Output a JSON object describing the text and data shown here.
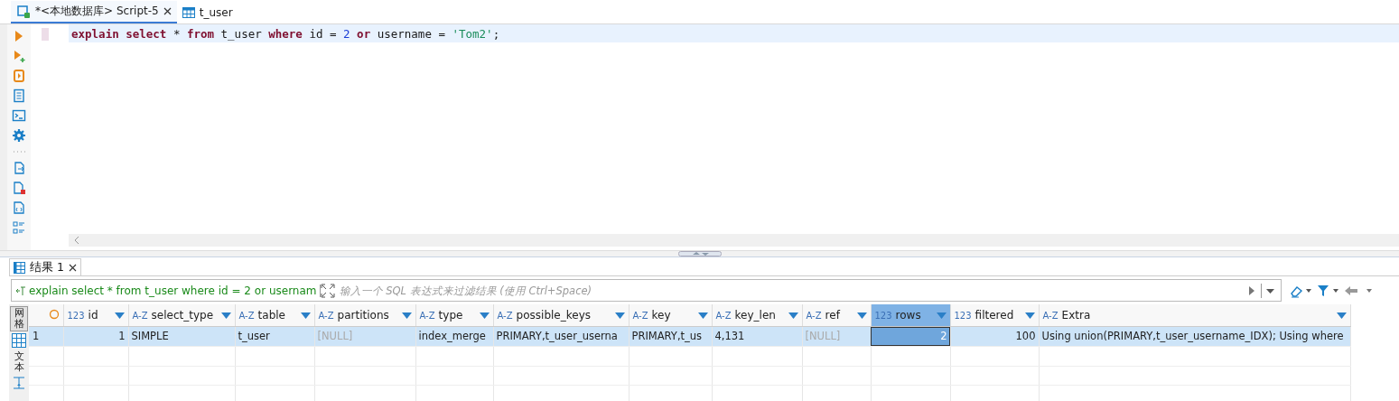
{
  "editor_tabs": [
    {
      "label": "*<本地数据库> Script-5",
      "selected": true,
      "closable": true,
      "kind": "script"
    },
    {
      "label": "t_user",
      "selected": false,
      "closable": false,
      "kind": "table"
    }
  ],
  "code": [
    {
      "kind": "keyword",
      "text": "explain select"
    },
    {
      "kind": "plain",
      "text": " * "
    },
    {
      "kind": "keyword",
      "text": "from"
    },
    {
      "kind": "plain",
      "text": " t_user "
    },
    {
      "kind": "keyword",
      "text": "where"
    },
    {
      "kind": "plain",
      "text": " id = "
    },
    {
      "kind": "number",
      "text": "2"
    },
    {
      "kind": "keyword",
      "text": " or"
    },
    {
      "kind": "plain",
      "text": " username = "
    },
    {
      "kind": "string",
      "text": "'Tom2'"
    },
    {
      "kind": "plain",
      "text": ";"
    }
  ],
  "result_tabs": [
    {
      "label": "结果 1",
      "selected": true
    }
  ],
  "filter": {
    "query": "explain select * from t_user where id = 2 or usernam",
    "placeholder": "输入一个 SQL 表达式来过滤结果 (使用 Ctrl+Space)"
  },
  "view_modes": [
    {
      "label": "网格",
      "selected": true
    },
    {
      "label": "文本",
      "selected": false
    }
  ],
  "columns": [
    {
      "name": "id",
      "type_badge": "123",
      "kind": "number",
      "selected": false
    },
    {
      "name": "select_type",
      "type_badge": "A-Z",
      "kind": "text",
      "selected": false
    },
    {
      "name": "table",
      "type_badge": "A-Z",
      "kind": "text",
      "selected": false
    },
    {
      "name": "partitions",
      "type_badge": "A-Z",
      "kind": "text",
      "selected": false
    },
    {
      "name": "type",
      "type_badge": "A-Z",
      "kind": "text",
      "selected": false
    },
    {
      "name": "possible_keys",
      "type_badge": "A-Z",
      "kind": "text",
      "selected": false
    },
    {
      "name": "key",
      "type_badge": "A-Z",
      "kind": "text",
      "selected": false
    },
    {
      "name": "key_len",
      "type_badge": "A-Z",
      "kind": "text",
      "selected": false
    },
    {
      "name": "ref",
      "type_badge": "A-Z",
      "kind": "text",
      "selected": false
    },
    {
      "name": "rows",
      "type_badge": "123",
      "kind": "number",
      "selected": true
    },
    {
      "name": "filtered",
      "type_badge": "123",
      "kind": "number",
      "selected": false
    },
    {
      "name": "Extra",
      "type_badge": "A-Z",
      "kind": "text",
      "selected": false
    }
  ],
  "rows": [
    {
      "number": "1",
      "selected": true,
      "cells": [
        {
          "text": "1",
          "is_null": false,
          "selected": false
        },
        {
          "text": "SIMPLE",
          "is_null": false,
          "selected": false
        },
        {
          "text": "t_user",
          "is_null": false,
          "selected": false
        },
        {
          "text": "[NULL]",
          "is_null": true,
          "selected": false
        },
        {
          "text": "index_merge",
          "is_null": false,
          "selected": false
        },
        {
          "text": "PRIMARY,t_user_userna",
          "is_null": false,
          "selected": false
        },
        {
          "text": "PRIMARY,t_us",
          "is_null": false,
          "selected": false
        },
        {
          "text": "4,131",
          "is_null": false,
          "selected": false
        },
        {
          "text": "[NULL]",
          "is_null": true,
          "selected": false
        },
        {
          "text": "2",
          "is_null": false,
          "selected": true
        },
        {
          "text": "100",
          "is_null": false,
          "selected": false
        },
        {
          "text": "Using union(PRIMARY,t_user_username_IDX); Using where",
          "is_null": false,
          "selected": false
        }
      ]
    }
  ]
}
